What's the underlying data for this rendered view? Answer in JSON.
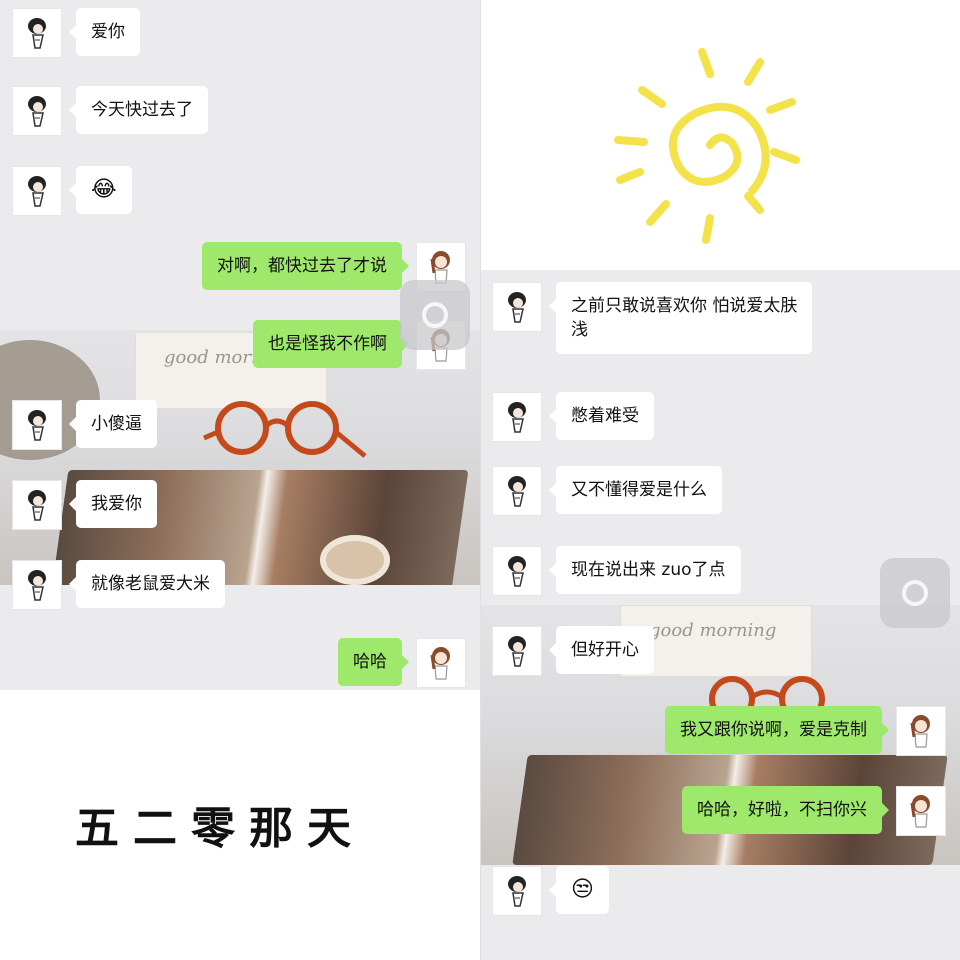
{
  "left_chat": {
    "messages": [
      {
        "side": "left",
        "text": "爱你"
      },
      {
        "side": "left",
        "text": "今天快过去了"
      },
      {
        "side": "left",
        "text": "😂"
      },
      {
        "side": "right",
        "text": "对啊，都快过去了才说"
      },
      {
        "side": "right",
        "text": "也是怪我不作啊"
      },
      {
        "side": "left",
        "text": "小傻逼"
      },
      {
        "side": "left",
        "text": "我爱你"
      },
      {
        "side": "left",
        "text": "就像老鼠爱大米"
      },
      {
        "side": "right",
        "text": "哈哈"
      }
    ]
  },
  "caption": "五二零那天",
  "right_chat": {
    "messages": [
      {
        "side": "left",
        "text": "之前只敢说喜欢你 怕说爱太肤\n浅"
      },
      {
        "side": "left",
        "text": "憋着难受"
      },
      {
        "side": "left",
        "text": "又不懂得爱是什么"
      },
      {
        "side": "left",
        "text": "现在说出来 zuo了点"
      },
      {
        "side": "left",
        "text": "但好开心"
      },
      {
        "side": "right",
        "text": "我又跟你说啊，爱是克制"
      },
      {
        "side": "right",
        "text": "哈哈，好啦，不扫你兴"
      },
      {
        "side": "left",
        "text": "😒"
      }
    ]
  },
  "photo_card_text": "good morning",
  "icons": {
    "sun": "sun-doodle-icon",
    "avatar_left": "boy-avatar-icon",
    "avatar_right": "girl-avatar-icon",
    "assist": "assistive-touch-icon"
  },
  "colors": {
    "bubble_me": "#9ee86b",
    "bubble_other": "#ffffff",
    "chat_bg": "#ebebee",
    "sun": "#f4e24a"
  }
}
